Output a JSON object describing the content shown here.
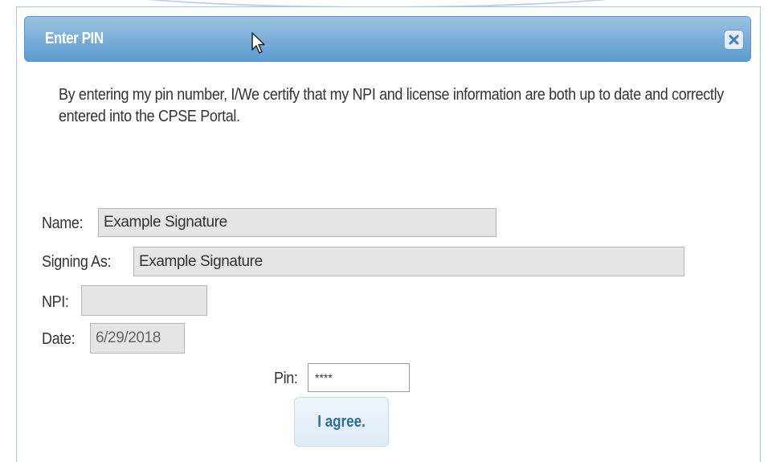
{
  "dialog": {
    "title": "Enter PIN",
    "close_icon": "close-icon",
    "message": "By entering my pin number, I/We certify that my NPI and license information are both up to date and correctly entered into the CPSE Portal."
  },
  "form": {
    "name_label": "Name:",
    "name_value": "Example Signature",
    "signing_as_label": "Signing As:",
    "signing_as_value": "Example Signature",
    "npi_label": "NPI:",
    "npi_value": "",
    "date_label": "Date:",
    "date_value": "6/29/2018",
    "pin_label": "Pin:",
    "pin_value": "****",
    "agree_label": "I agree."
  },
  "colors": {
    "titlebar": "#7fb0d9",
    "title_text": "#ffffff",
    "button_text": "#2e6e9e",
    "field_background": "#e5e5e5"
  },
  "icons": {
    "cursor": "mouse-pointer-icon"
  }
}
